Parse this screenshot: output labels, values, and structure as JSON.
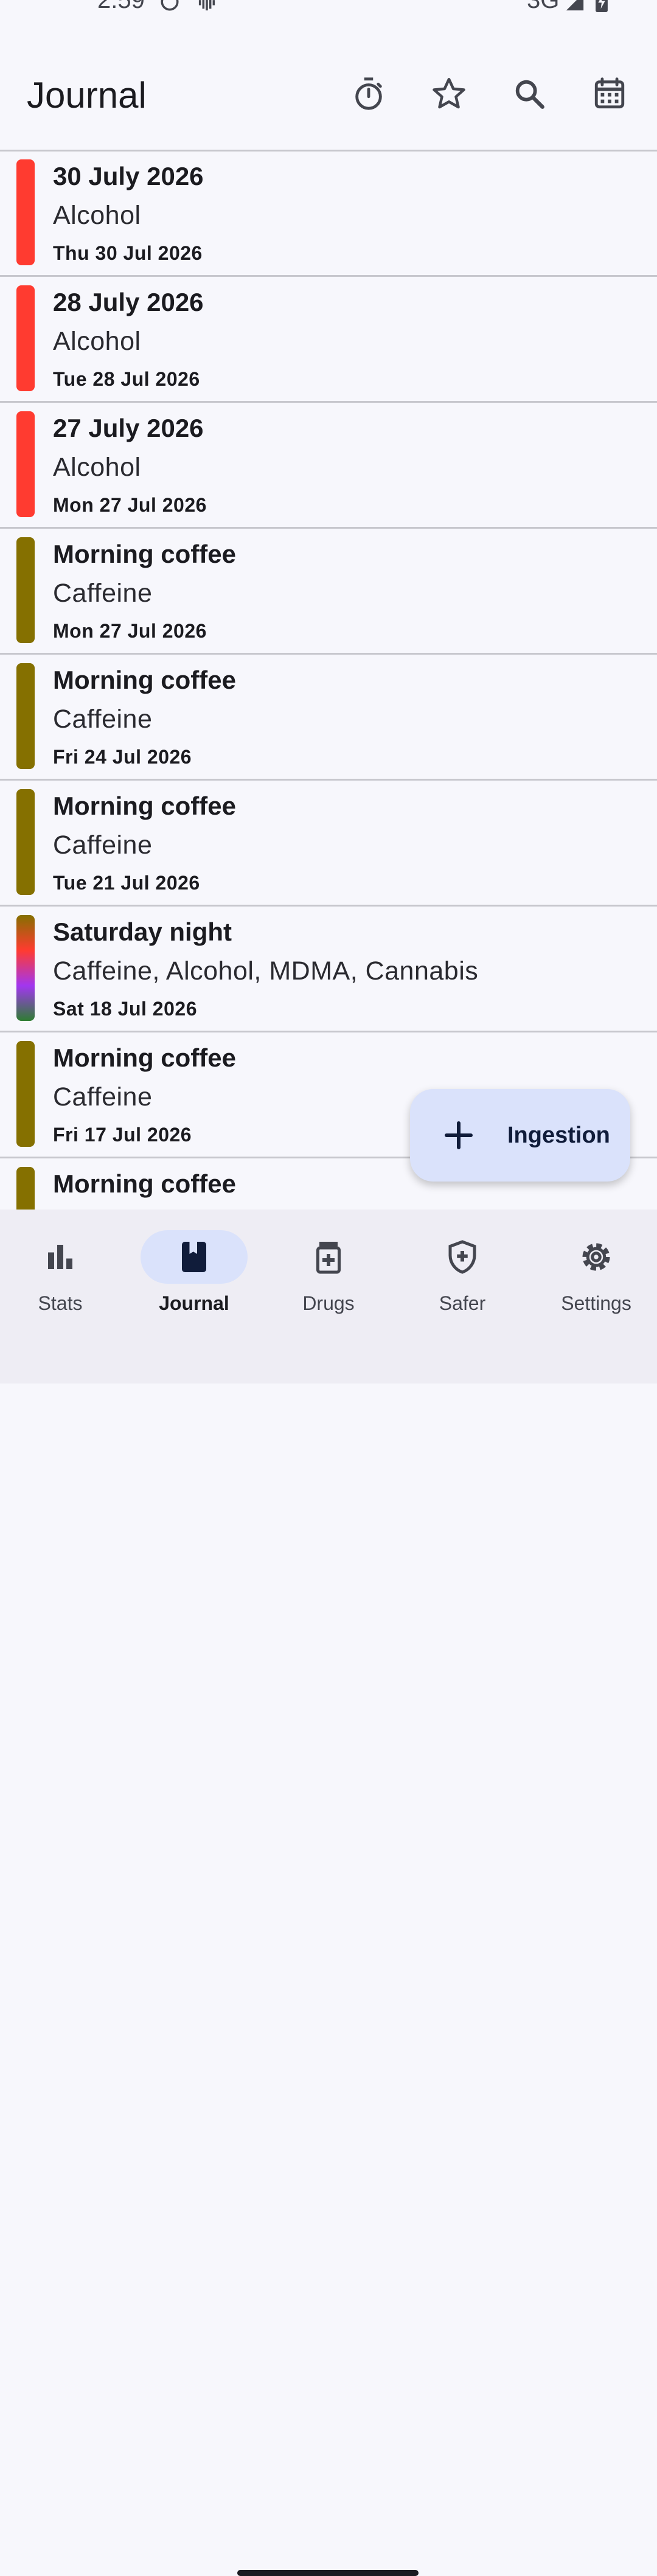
{
  "status": {
    "time": "2:59",
    "network": "3G"
  },
  "appbar": {
    "title": "Journal"
  },
  "experiences": [
    {
      "title": "30 July 2026",
      "substances": "Alcohol",
      "date": "Thu 30 Jul 2026",
      "color": "#ff3b30"
    },
    {
      "title": "28 July 2026",
      "substances": "Alcohol",
      "date": "Tue 28 Jul 2026",
      "color": "#ff3b30"
    },
    {
      "title": "27 July 2026",
      "substances": "Alcohol",
      "date": "Mon 27 Jul 2026",
      "color": "#ff3b30"
    },
    {
      "title": "Morning coffee",
      "substances": "Caffeine",
      "date": "Mon 27 Jul 2026",
      "color": "#857000"
    },
    {
      "title": "Morning coffee",
      "substances": "Caffeine",
      "date": "Fri 24 Jul 2026",
      "color": "#857000"
    },
    {
      "title": "Morning coffee",
      "substances": "Caffeine",
      "date": "Tue 21 Jul 2026",
      "color": "#857000"
    },
    {
      "title": "Saturday night",
      "substances": "Caffeine, Alcohol, MDMA, Cannabis",
      "date": "Sat 18 Jul 2026",
      "colors": [
        "#857000",
        "#ff3b30",
        "#a236f0",
        "#2e7d32"
      ]
    },
    {
      "title": "Morning coffee",
      "substances": "Caffeine",
      "date": "Fri 17 Jul 2026",
      "color": "#857000"
    },
    {
      "title": "Morning coffee",
      "substances": "",
      "date": "",
      "color": "#857000"
    }
  ],
  "fab": {
    "label": "Ingestion"
  },
  "nav": [
    {
      "label": "Stats",
      "icon": "bar-chart-icon",
      "active": false
    },
    {
      "label": "Journal",
      "icon": "book-icon",
      "active": true
    },
    {
      "label": "Drugs",
      "icon": "medication-icon",
      "active": false
    },
    {
      "label": "Safer",
      "icon": "shield-plus-icon",
      "active": false
    },
    {
      "label": "Settings",
      "icon": "gear-icon",
      "active": false
    }
  ]
}
